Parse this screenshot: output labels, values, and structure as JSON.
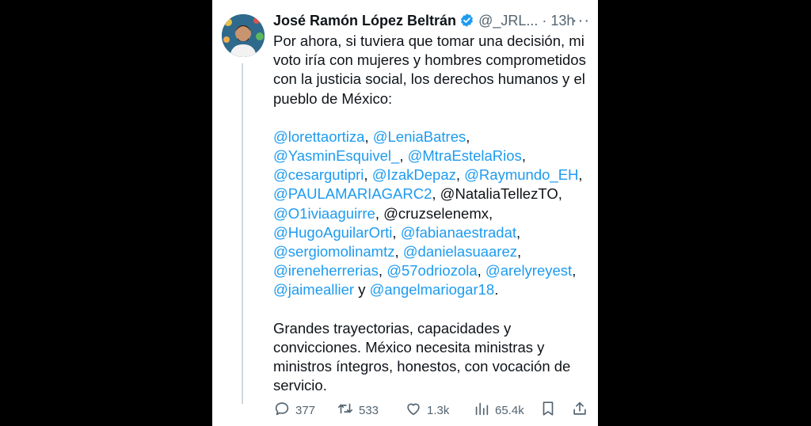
{
  "tweet": {
    "author_name": "José Ramón López Beltrán",
    "handle": "@_JRL...",
    "separator": "·",
    "time": "13h",
    "more": "···",
    "intro": "Por ahora, si tuviera que tomar una decisión, mi voto iría con mujeres y hombres comprometidos con la justicia social, los derechos humanos y el pueblo de México:",
    "mentions": {
      "m1": "@lorettaortiza",
      "c1": ", ",
      "m2": "@LeniaBatres",
      "c2": ",",
      "m3": "@YasminEsquivel_",
      "c3": ", ",
      "m4": "@MtraEstelaRios",
      "c4": ",",
      "m5": "@cesargutipri",
      "c5": ", ",
      "m6": "@IzakDepaz",
      "c6": ", ",
      "m7": "@Raymundo_EH",
      "c7": ",",
      "m8": "@PAULAMARIAGARC2",
      "c8": ", @NataliaTellezTO,",
      "m9": "@O1iviaaguirre",
      "c9": ", @cruzselenemx,",
      "m10": "@HugoAguilarOrti",
      "c10": ", ",
      "m11": "@fabianaestradat",
      "c11": ",",
      "m12": "@sergiomolinamtz",
      "c12": ", ",
      "m13": "@danielasuaarez",
      "c13": ",",
      "m14": "@ireneherrerias",
      "c14": ", ",
      "m15": "@57odriozola",
      "c15": ", ",
      "m16": "@arelyreyest",
      "c16": ",",
      "m17": "@jaimeallier",
      "c17": " y ",
      "m18": "@angelmariogar18",
      "c18": "."
    },
    "closing": "Grandes trayectorias, capacidades y convicciones. México necesita ministras y ministros íntegros, honestos, con vocación de servicio."
  },
  "actions": {
    "replies": "377",
    "reposts": "533",
    "likes": "1.3k",
    "views": "65.4k"
  },
  "icons": [
    "verified-badge-icon",
    "more-icon",
    "reply-icon",
    "repost-icon",
    "like-icon",
    "views-icon",
    "bookmark-icon",
    "share-icon"
  ],
  "colors": {
    "mention": "#1d9bf0",
    "text": "#0f1419",
    "muted": "#536471",
    "verified": "#1d9bf0"
  }
}
